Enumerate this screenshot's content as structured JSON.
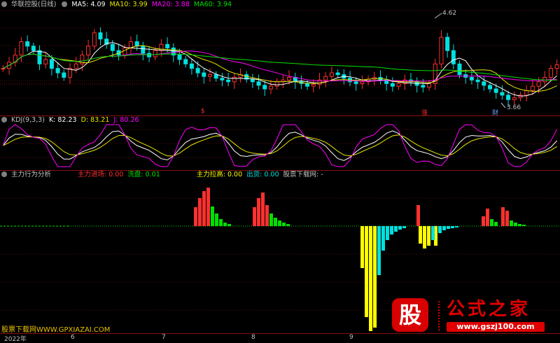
{
  "main": {
    "title": "华联控股(日线)",
    "ma5": "MA5: 4.09",
    "ma10": "MA10: 3.99",
    "ma20": "MA20: 3.88",
    "ma60": "MA60: 3.94",
    "high_label": "4.62",
    "low_label": "3.66",
    "flags": [
      "$",
      "涨",
      "财"
    ],
    "colors": {
      "ma5": "#ffffff",
      "ma10": "#e6e600",
      "ma20": "#ff00ff",
      "ma60": "#00e000",
      "up": "#ff3030",
      "down": "#00e0e0"
    }
  },
  "kdj": {
    "title": "KDJ(9,3,3)",
    "k": "K: 82.23",
    "d": "D: 83.21",
    "j": "J: 80.26"
  },
  "indicator": {
    "title": "主力行为分析",
    "enter": "主力进场: 0.00",
    "wash": "洗盘: 0.01",
    "pull": "主力拉高: 0.00",
    "out": "出货: 0.00",
    "site": "股票下载网: -",
    "colors": {
      "enter": "#ff3030",
      "wash": "#00e000",
      "pull": "#ffff00",
      "out": "#00e0e0"
    }
  },
  "xaxis": {
    "labels": [
      "2022年",
      "6",
      "7",
      "8",
      "9"
    ]
  },
  "watermark": "股票下载网WWW.GPXIAZAI.COM",
  "logo": {
    "mark": "股",
    "name": "公式之家",
    "url": "www.gszj100.com"
  },
  "chart_data": {
    "type": "candlestick",
    "close": [
      4.05,
      4.12,
      4.2,
      4.35,
      4.3,
      4.25,
      4.1,
      4.15,
      4.05,
      4.0,
      3.95,
      4.05,
      4.1,
      4.2,
      4.3,
      4.45,
      4.38,
      4.32,
      4.25,
      4.2,
      4.28,
      4.35,
      4.3,
      4.22,
      4.18,
      4.25,
      4.32,
      4.28,
      4.2,
      4.15,
      4.1,
      4.05,
      4.0,
      3.96,
      3.98,
      3.94,
      3.92,
      3.9,
      3.95,
      3.98,
      3.93,
      3.9,
      3.86,
      3.82,
      3.85,
      3.9,
      3.92,
      3.95,
      3.9,
      3.88,
      3.85,
      3.87,
      3.92,
      3.96,
      4.0,
      3.98,
      3.94,
      3.9,
      3.88,
      3.9,
      3.93,
      3.95,
      3.92,
      3.88,
      3.85,
      3.88,
      3.92,
      3.9,
      3.86,
      3.84,
      3.88,
      4.1,
      4.4,
      4.25,
      4.1,
      3.98,
      3.95,
      3.92,
      3.9,
      3.86,
      3.82,
      3.78,
      3.75,
      3.7,
      3.72,
      3.75,
      3.8,
      3.85,
      3.9,
      3.95,
      4.05,
      4.09
    ],
    "high": 4.62,
    "low": 3.66
  }
}
